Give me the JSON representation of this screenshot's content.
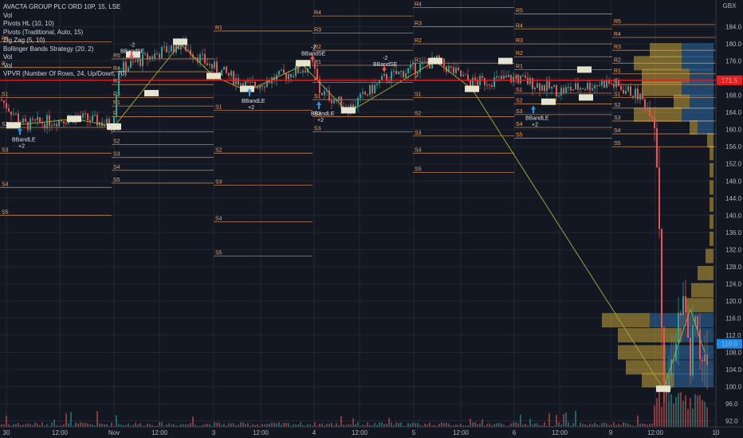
{
  "chart_data": {
    "type": "candlestick",
    "title": "AVACTA GROUP PLC ORD 10P, 15, LSE",
    "currency": "GBX",
    "ylim": [
      90,
      188
    ],
    "y_ticks": [
      92.0,
      96.0,
      100.0,
      104.0,
      108.0,
      112.0,
      116.0,
      120.0,
      124.0,
      128.0,
      132.0,
      136.0,
      140.0,
      144.0,
      148.0,
      152.0,
      156.0,
      160.0,
      164.0,
      168.0,
      172.0,
      176.0,
      180.0,
      184.0
    ],
    "x_ticks": [
      "30",
      "12:00",
      "Nov",
      "12:00",
      "3",
      "12:00",
      "4",
      "12:00",
      "5",
      "12:00",
      "6",
      "12:00",
      "9",
      "12:00",
      "10"
    ],
    "last_price": "171.5",
    "current_price": "110.0",
    "grid": true
  },
  "legend": [
    {
      "id": "title",
      "text": "AVACTA GROUP PLC ORD 10P, 15, LSE"
    },
    {
      "id": "vol1",
      "text": "Vol"
    },
    {
      "id": "pivotshl",
      "text": "Pivots HL (10, 10)"
    },
    {
      "id": "pivotstrad",
      "text": "Pivots (Traditional, Auto, 15)"
    },
    {
      "id": "zigzag",
      "text": "Zig Zag (5, 10)"
    },
    {
      "id": "bbstrat",
      "text": "Bollinger Bands Strategy (20, 2)"
    },
    {
      "id": "vol2",
      "text": "Vol"
    },
    {
      "id": "vol3",
      "text": "Vol"
    },
    {
      "id": "vpvr",
      "text": "VPVR (Number Of Rows, 24, Up/Down, 70)"
    }
  ],
  "pivot_sets": [
    {
      "x1": 0,
      "x2": 140,
      "levels": [
        {
          "label": "R1",
          "price": 180.5
        },
        {
          "label": "P",
          "price": 174.5
        },
        {
          "label": "S1",
          "price": 167.5
        },
        {
          "label": "S2",
          "price": 160.5
        },
        {
          "label": "S3",
          "price": 154.5
        },
        {
          "label": "S4",
          "price": 146.5
        },
        {
          "label": "S5",
          "price": 140.0
        }
      ]
    },
    {
      "x1": 140,
      "x2": 268,
      "levels": [
        {
          "label": "R5",
          "price": 176.5
        },
        {
          "label": "R4",
          "price": 173.5
        },
        {
          "label": "R3",
          "price": 170.5
        },
        {
          "label": "R2",
          "price": 167.5
        },
        {
          "label": "R1",
          "price": 165.5
        },
        {
          "label": "P",
          "price": 163.0
        },
        {
          "label": "S1",
          "price": 159.5
        },
        {
          "label": "S2",
          "price": 156.5
        },
        {
          "label": "S3",
          "price": 153.5
        },
        {
          "label": "S4",
          "price": 150.5
        },
        {
          "label": "S5",
          "price": 147.5
        }
      ]
    },
    {
      "x1": 268,
      "x2": 392,
      "levels": [
        {
          "label": "R1",
          "price": 183.0
        },
        {
          "label": "P",
          "price": 171.5
        },
        {
          "label": "S1",
          "price": 164.5
        },
        {
          "label": "S2",
          "price": 154.5
        },
        {
          "label": "S3",
          "price": 147.0
        },
        {
          "label": "S4",
          "price": 138.5
        },
        {
          "label": "S5",
          "price": 130.5
        }
      ]
    },
    {
      "x1": 392,
      "x2": 518,
      "levels": [
        {
          "label": "R4",
          "price": 186.5
        },
        {
          "label": "R3",
          "price": 182.5
        },
        {
          "label": "R2",
          "price": 178.5
        },
        {
          "label": "R1",
          "price": 175.0
        },
        {
          "label": "P",
          "price": 171.0
        },
        {
          "label": "S1",
          "price": 167.0
        },
        {
          "label": "S2",
          "price": 163.0
        },
        {
          "label": "S3",
          "price": 159.5
        }
      ]
    },
    {
      "x1": 518,
      "x2": 645,
      "levels": [
        {
          "label": "R4",
          "price": 188.5
        },
        {
          "label": "R3",
          "price": 184.0
        },
        {
          "label": "R2",
          "price": 180.0
        },
        {
          "label": "R1",
          "price": 175.5
        },
        {
          "label": "P",
          "price": 171.5
        },
        {
          "label": "S1",
          "price": 167.5
        },
        {
          "label": "S2",
          "price": 163.0
        },
        {
          "label": "S3",
          "price": 158.5
        },
        {
          "label": "S4",
          "price": 154.5
        },
        {
          "label": "S5",
          "price": 150.0
        }
      ]
    },
    {
      "x1": 645,
      "x2": 768,
      "levels": [
        {
          "label": "R5",
          "price": 187.0
        },
        {
          "label": "R4",
          "price": 183.5
        },
        {
          "label": "R3",
          "price": 180.0
        },
        {
          "label": "R2",
          "price": 177.0
        },
        {
          "label": "R1",
          "price": 174.0
        },
        {
          "label": "P",
          "price": 171.5
        },
        {
          "label": "S1",
          "price": 168.5
        },
        {
          "label": "S2",
          "price": 166.0
        },
        {
          "label": "S3",
          "price": 163.5
        },
        {
          "label": "S4",
          "price": 160.5
        },
        {
          "label": "S5",
          "price": 158.0
        }
      ]
    },
    {
      "x1": 768,
      "x2": 898,
      "levels": [
        {
          "label": "R5",
          "price": 184.5
        },
        {
          "label": "R4",
          "price": 181.5
        },
        {
          "label": "R3",
          "price": 178.5
        },
        {
          "label": "R2",
          "price": 175.5
        },
        {
          "label": "R1",
          "price": 173.0
        },
        {
          "label": "P",
          "price": 170.5
        },
        {
          "label": "S1",
          "price": 167.5
        },
        {
          "label": "S2",
          "price": 165.0
        },
        {
          "label": "S3",
          "price": 162.0
        },
        {
          "label": "S4",
          "price": 159.0
        },
        {
          "label": "S5",
          "price": 156.0
        }
      ]
    }
  ],
  "vpvr": [
    {
      "price": 178.5,
      "up": 40,
      "down": 40
    },
    {
      "price": 175.5,
      "up": 60,
      "down": 40
    },
    {
      "price": 172.5,
      "up": 60,
      "down": 30
    },
    {
      "price": 169.5,
      "up": 50,
      "down": 40
    },
    {
      "price": 166.5,
      "up": 20,
      "down": 30
    },
    {
      "price": 163.5,
      "up": 60,
      "down": 40
    },
    {
      "price": 160.5,
      "up": 10,
      "down": 20
    },
    {
      "price": 157.5,
      "up": 8,
      "down": 0
    },
    {
      "price": 154.5,
      "up": 5,
      "down": 0
    },
    {
      "price": 150.5,
      "up": 5,
      "down": 0
    },
    {
      "price": 146.5,
      "up": 5,
      "down": 0
    },
    {
      "price": 142.5,
      "up": 5,
      "down": 0
    },
    {
      "price": 138.5,
      "up": 5,
      "down": 0
    },
    {
      "price": 134.5,
      "up": 5,
      "down": 0
    },
    {
      "price": 130.5,
      "up": 10,
      "down": 0
    },
    {
      "price": 126.5,
      "up": 20,
      "down": 0
    },
    {
      "price": 122.5,
      "up": 28,
      "down": 0
    },
    {
      "price": 119.0,
      "up": 35,
      "down": 0
    },
    {
      "price": 115.5,
      "up": 60,
      "down": 80
    },
    {
      "price": 112.0,
      "up": 80,
      "down": 40
    },
    {
      "price": 108.0,
      "up": 60,
      "down": 60
    },
    {
      "price": 104.5,
      "up": 50,
      "down": 60
    },
    {
      "price": 101.5,
      "up": 40,
      "down": 50
    }
  ],
  "annotations": [
    {
      "x": 25,
      "price": 161.0,
      "text": "BBandLE",
      "sub": "+2",
      "dir": "up"
    },
    {
      "x": 165,
      "price": 176.0,
      "text": "BBandSE",
      "sub": "-2",
      "dir": "down"
    },
    {
      "x": 313,
      "price": 170.0,
      "text": "BBandLE",
      "sub": "+2",
      "dir": "up"
    },
    {
      "x": 392,
      "price": 175.5,
      "text": "BBandSE",
      "sub": "-2",
      "dir": "down"
    },
    {
      "x": 400,
      "price": 167.0,
      "text": "BBandLE",
      "sub": "+2",
      "dir": "up"
    },
    {
      "x": 482,
      "price": 173.0,
      "text": "BBandSE",
      "sub": "-2",
      "dir": "down"
    },
    {
      "x": 669,
      "price": 166.0,
      "text": "BBandLE",
      "sub": "+2",
      "dir": "up"
    }
  ],
  "price_tags": [
    {
      "x": 17,
      "price": 161.0,
      "text": "161.1"
    },
    {
      "x": 93,
      "price": 162.5,
      "text": "162.2"
    },
    {
      "x": 143,
      "price": 160.7,
      "text": "160.7"
    },
    {
      "x": 167,
      "price": 177.5,
      "text": "176.8"
    },
    {
      "x": 190,
      "price": 168.5,
      "text": "168.5"
    },
    {
      "x": 226,
      "price": 180.5,
      "text": "180.0"
    },
    {
      "x": 268,
      "price": 172.5,
      "text": "172.5"
    },
    {
      "x": 310,
      "price": 169.5,
      "text": "169.0"
    },
    {
      "x": 380,
      "price": 175.5,
      "text": "175.0"
    },
    {
      "x": 437,
      "price": 164.5,
      "text": "164.0"
    },
    {
      "x": 546,
      "price": 176.0,
      "text": "176.0"
    },
    {
      "x": 592,
      "price": 169.5,
      "text": "169.5"
    },
    {
      "x": 634,
      "price": 176.0,
      "text": "176.0"
    },
    {
      "x": 688,
      "price": 166.5,
      "text": "166.5"
    },
    {
      "x": 733,
      "price": 174.0,
      "text": "174.0"
    },
    {
      "x": 735,
      "price": 167.5,
      "text": "167.5"
    },
    {
      "x": 832,
      "price": 99.5,
      "text": "99.5"
    }
  ],
  "colors": {
    "bg": "#131722",
    "grid": "#232733",
    "text": "#b2b5be",
    "up": "#26a69a",
    "down": "#ef5350",
    "pivot": "#f7a35c",
    "zigzag": "#9ea23a",
    "vp_up": "#c9a43a",
    "vp_down": "#2e6ea6",
    "last_price": "#ef1e1e",
    "current_price": "#1e88e5"
  }
}
